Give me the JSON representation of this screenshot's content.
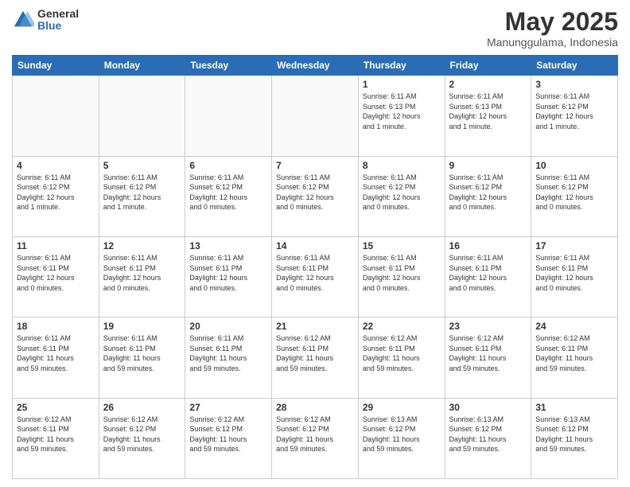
{
  "logo": {
    "general": "General",
    "blue": "Blue"
  },
  "title": "May 2025",
  "subtitle": "Manunggulama, Indonesia",
  "days_header": [
    "Sunday",
    "Monday",
    "Tuesday",
    "Wednesday",
    "Thursday",
    "Friday",
    "Saturday"
  ],
  "weeks": [
    [
      {
        "day": "",
        "info": ""
      },
      {
        "day": "",
        "info": ""
      },
      {
        "day": "",
        "info": ""
      },
      {
        "day": "",
        "info": ""
      },
      {
        "day": "1",
        "info": "Sunrise: 6:11 AM\nSunset: 6:13 PM\nDaylight: 12 hours\nand 1 minute."
      },
      {
        "day": "2",
        "info": "Sunrise: 6:11 AM\nSunset: 6:13 PM\nDaylight: 12 hours\nand 1 minute."
      },
      {
        "day": "3",
        "info": "Sunrise: 6:11 AM\nSunset: 6:12 PM\nDaylight: 12 hours\nand 1 minute."
      }
    ],
    [
      {
        "day": "4",
        "info": "Sunrise: 6:11 AM\nSunset: 6:12 PM\nDaylight: 12 hours\nand 1 minute."
      },
      {
        "day": "5",
        "info": "Sunrise: 6:11 AM\nSunset: 6:12 PM\nDaylight: 12 hours\nand 1 minute."
      },
      {
        "day": "6",
        "info": "Sunrise: 6:11 AM\nSunset: 6:12 PM\nDaylight: 12 hours\nand 0 minutes."
      },
      {
        "day": "7",
        "info": "Sunrise: 6:11 AM\nSunset: 6:12 PM\nDaylight: 12 hours\nand 0 minutes."
      },
      {
        "day": "8",
        "info": "Sunrise: 6:11 AM\nSunset: 6:12 PM\nDaylight: 12 hours\nand 0 minutes."
      },
      {
        "day": "9",
        "info": "Sunrise: 6:11 AM\nSunset: 6:12 PM\nDaylight: 12 hours\nand 0 minutes."
      },
      {
        "day": "10",
        "info": "Sunrise: 6:11 AM\nSunset: 6:12 PM\nDaylight: 12 hours\nand 0 minutes."
      }
    ],
    [
      {
        "day": "11",
        "info": "Sunrise: 6:11 AM\nSunset: 6:11 PM\nDaylight: 12 hours\nand 0 minutes."
      },
      {
        "day": "12",
        "info": "Sunrise: 6:11 AM\nSunset: 6:11 PM\nDaylight: 12 hours\nand 0 minutes."
      },
      {
        "day": "13",
        "info": "Sunrise: 6:11 AM\nSunset: 6:11 PM\nDaylight: 12 hours\nand 0 minutes."
      },
      {
        "day": "14",
        "info": "Sunrise: 6:11 AM\nSunset: 6:11 PM\nDaylight: 12 hours\nand 0 minutes."
      },
      {
        "day": "15",
        "info": "Sunrise: 6:11 AM\nSunset: 6:11 PM\nDaylight: 12 hours\nand 0 minutes."
      },
      {
        "day": "16",
        "info": "Sunrise: 6:11 AM\nSunset: 6:11 PM\nDaylight: 12 hours\nand 0 minutes."
      },
      {
        "day": "17",
        "info": "Sunrise: 6:11 AM\nSunset: 6:11 PM\nDaylight: 12 hours\nand 0 minutes."
      }
    ],
    [
      {
        "day": "18",
        "info": "Sunrise: 6:11 AM\nSunset: 6:11 PM\nDaylight: 11 hours\nand 59 minutes."
      },
      {
        "day": "19",
        "info": "Sunrise: 6:11 AM\nSunset: 6:11 PM\nDaylight: 11 hours\nand 59 minutes."
      },
      {
        "day": "20",
        "info": "Sunrise: 6:11 AM\nSunset: 6:11 PM\nDaylight: 11 hours\nand 59 minutes."
      },
      {
        "day": "21",
        "info": "Sunrise: 6:12 AM\nSunset: 6:11 PM\nDaylight: 11 hours\nand 59 minutes."
      },
      {
        "day": "22",
        "info": "Sunrise: 6:12 AM\nSunset: 6:11 PM\nDaylight: 11 hours\nand 59 minutes."
      },
      {
        "day": "23",
        "info": "Sunrise: 6:12 AM\nSunset: 6:11 PM\nDaylight: 11 hours\nand 59 minutes."
      },
      {
        "day": "24",
        "info": "Sunrise: 6:12 AM\nSunset: 6:11 PM\nDaylight: 11 hours\nand 59 minutes."
      }
    ],
    [
      {
        "day": "25",
        "info": "Sunrise: 6:12 AM\nSunset: 6:11 PM\nDaylight: 11 hours\nand 59 minutes."
      },
      {
        "day": "26",
        "info": "Sunrise: 6:12 AM\nSunset: 6:12 PM\nDaylight: 11 hours\nand 59 minutes."
      },
      {
        "day": "27",
        "info": "Sunrise: 6:12 AM\nSunset: 6:12 PM\nDaylight: 11 hours\nand 59 minutes."
      },
      {
        "day": "28",
        "info": "Sunrise: 6:12 AM\nSunset: 6:12 PM\nDaylight: 11 hours\nand 59 minutes."
      },
      {
        "day": "29",
        "info": "Sunrise: 6:13 AM\nSunset: 6:12 PM\nDaylight: 11 hours\nand 59 minutes."
      },
      {
        "day": "30",
        "info": "Sunrise: 6:13 AM\nSunset: 6:12 PM\nDaylight: 11 hours\nand 59 minutes."
      },
      {
        "day": "31",
        "info": "Sunrise: 6:13 AM\nSunset: 6:12 PM\nDaylight: 11 hours\nand 59 minutes."
      }
    ]
  ]
}
